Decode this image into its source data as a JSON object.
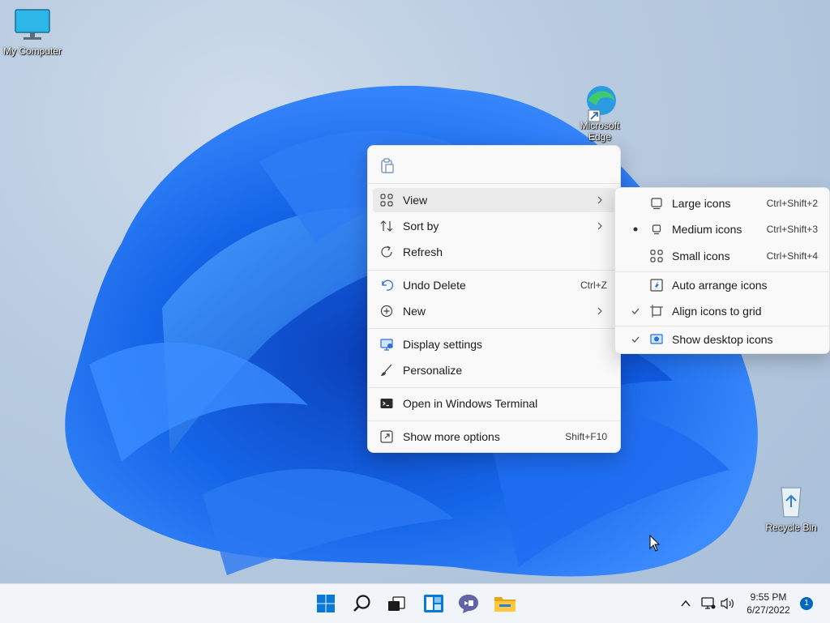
{
  "desktop": {
    "icons": [
      {
        "label": "My Computer"
      },
      {
        "label": "Microsoft Edge"
      },
      {
        "label": "Recycle Bin"
      }
    ]
  },
  "context_menu": {
    "top_icons": [
      "paste-icon"
    ],
    "items": [
      {
        "label": "View",
        "icon": "grid-icon",
        "has_submenu": true
      },
      {
        "label": "Sort by",
        "icon": "sort-icon",
        "has_submenu": true
      },
      {
        "label": "Refresh",
        "icon": "refresh-icon"
      },
      {
        "label": "Undo Delete",
        "icon": "undo-icon",
        "shortcut": "Ctrl+Z"
      },
      {
        "label": "New",
        "icon": "new-icon",
        "has_submenu": true
      },
      {
        "label": "Display settings",
        "icon": "display-icon"
      },
      {
        "label": "Personalize",
        "icon": "brush-icon"
      },
      {
        "label": "Open in Windows Terminal",
        "icon": "terminal-icon"
      },
      {
        "label": "Show more options",
        "icon": "more-options-icon",
        "shortcut": "Shift+F10"
      }
    ]
  },
  "view_submenu": {
    "items": [
      {
        "label": "Large icons",
        "shortcut": "Ctrl+Shift+2",
        "selected": false
      },
      {
        "label": "Medium icons",
        "shortcut": "Ctrl+Shift+3",
        "selected": true
      },
      {
        "label": "Small icons",
        "shortcut": "Ctrl+Shift+4",
        "selected": false
      },
      {
        "label": "Auto arrange icons",
        "checked": false
      },
      {
        "label": "Align icons to grid",
        "checked": true
      },
      {
        "label": "Show desktop icons",
        "checked": true
      }
    ]
  },
  "taskbar": {
    "apps": [
      "start-icon",
      "search-icon",
      "task-view-icon",
      "widgets-icon",
      "chat-icon",
      "file-explorer-icon"
    ],
    "clock": {
      "time": "9:55 PM",
      "date": "6/27/2022"
    },
    "notification_count": "1"
  },
  "colors": {
    "accent": "#0067c0",
    "menu_bg": "#f9f9f9",
    "taskbar_bg": "#f1f4f9"
  }
}
